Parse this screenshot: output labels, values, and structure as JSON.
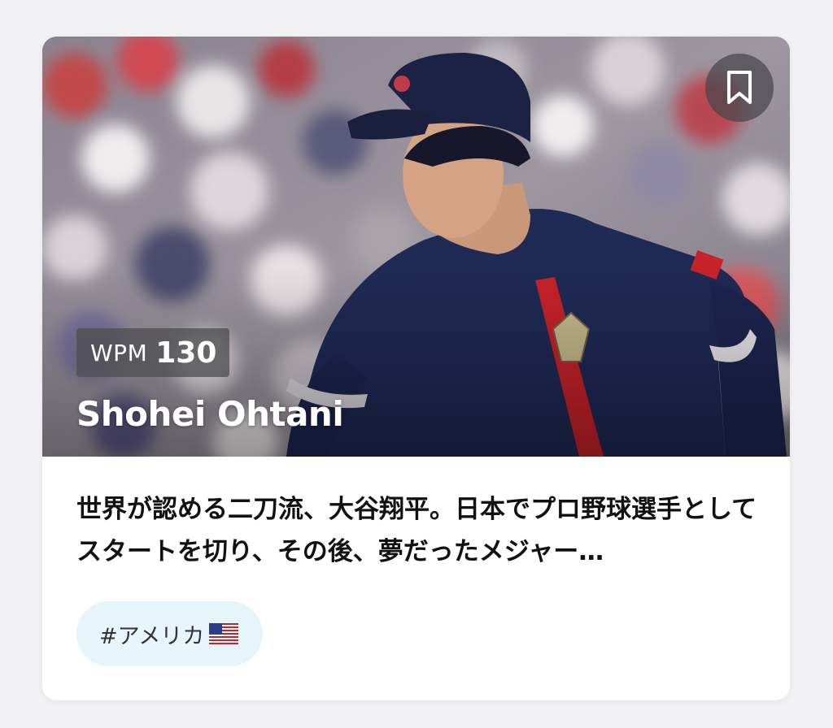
{
  "card": {
    "bookmark_icon": "bookmark-icon",
    "wpm": {
      "label": "WPM",
      "value": "130"
    },
    "name": "Shohei Ohtani",
    "description": "世界が認める二刀流、大谷翔平。日本でプロ野球選手としてスタートを切り、その後、夢だったメジャー…",
    "tag": {
      "label": "#アメリカ",
      "flag_icon": "us-flag-icon"
    }
  },
  "colors": {
    "jersey": "#1f2a55",
    "accent_red": "#c8222a",
    "tag_bg": "#e6f5fa",
    "page_bg": "#f2f2f4"
  }
}
